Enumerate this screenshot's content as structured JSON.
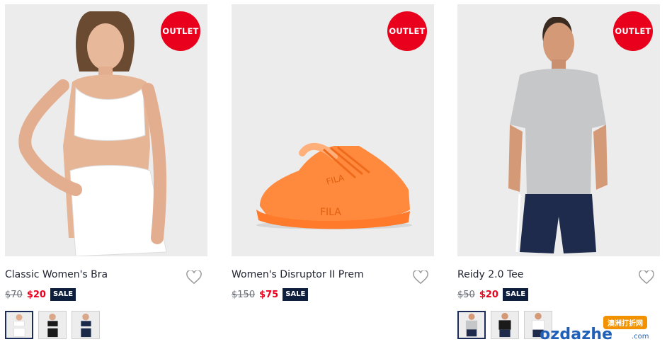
{
  "products": [
    {
      "badge": "OUTLET",
      "name": "Classic Women's Bra",
      "old_price": "$70",
      "price": "$20",
      "sale_label": "SALE",
      "swatch_count": 3,
      "colors": {
        "badge": "#e8001c",
        "price": "#e8001c",
        "sale": "#0d1f3d"
      }
    },
    {
      "badge": "OUTLET",
      "name": "Women's Disruptor II Prem",
      "old_price": "$150",
      "price": "$75",
      "sale_label": "SALE",
      "swatch_count": 0,
      "colors": {
        "badge": "#e8001c",
        "price": "#e8001c",
        "sale": "#0d1f3d"
      }
    },
    {
      "badge": "OUTLET",
      "name": "Reidy 2.0 Tee",
      "old_price": "$50",
      "price": "$20",
      "sale_label": "SALE",
      "swatch_count": 3,
      "colors": {
        "badge": "#e8001c",
        "price": "#e8001c",
        "sale": "#0d1f3d"
      }
    }
  ],
  "icons": {
    "wishlist": "heart-outline-icon"
  },
  "watermark": {
    "cn": "澳洲打折网",
    "en": "ozdazhe",
    "suffix": ".com"
  }
}
